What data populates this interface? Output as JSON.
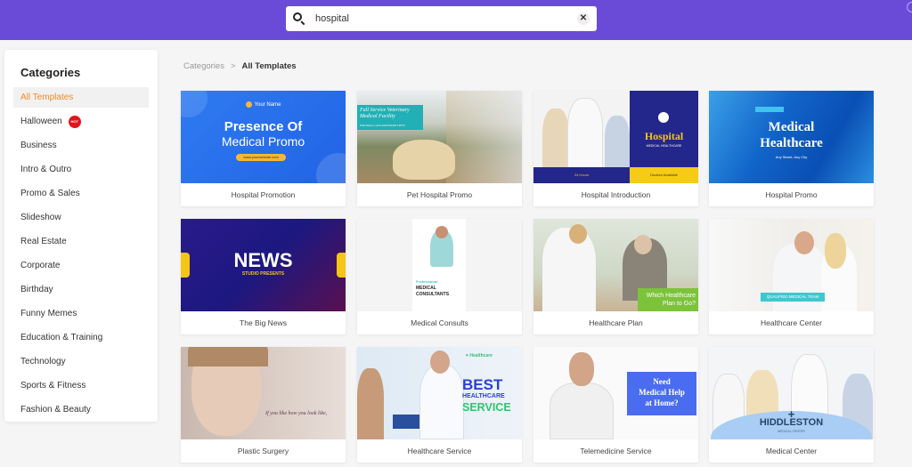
{
  "search": {
    "value": "hospital",
    "icon": "search-icon",
    "clear_icon": "close-icon"
  },
  "sidebar": {
    "title": "Categories",
    "items": [
      {
        "label": "All Templates",
        "active": true
      },
      {
        "label": "Halloween",
        "badge": "HOT"
      },
      {
        "label": "Business"
      },
      {
        "label": "Intro & Outro"
      },
      {
        "label": "Promo & Sales"
      },
      {
        "label": "Slideshow"
      },
      {
        "label": "Real Estate"
      },
      {
        "label": "Corporate"
      },
      {
        "label": "Birthday"
      },
      {
        "label": "Funny Memes"
      },
      {
        "label": "Education & Training"
      },
      {
        "label": "Technology"
      },
      {
        "label": "Sports & Fitness"
      },
      {
        "label": "Fashion & Beauty"
      }
    ]
  },
  "breadcrumb": {
    "root": "Categories",
    "separator": ">",
    "current": "All Templates"
  },
  "colors": {
    "topbar": "#6a4bd8",
    "active_category": "#f28a24",
    "hot_badge": "#e0161b"
  },
  "templates": [
    {
      "title": "Hospital Promotion",
      "thumb_text": [
        "Your Name",
        "Presence Of",
        "Medical Promo",
        "www.yourwebsite.com"
      ]
    },
    {
      "title": "Pet Hospital Promo",
      "thumb_text": [
        "Full Service Veterinary",
        "Medical Facility",
        "FOR DOGS, CATS AND POCKET PETS"
      ]
    },
    {
      "title": "Hospital Introduction",
      "thumb_text": [
        "Hospital",
        "MEDICAL HEALTHCARE",
        "24 Hours",
        "Doctors Available"
      ]
    },
    {
      "title": "Hospital Promo",
      "thumb_text": [
        "Medical",
        "Healthcare",
        "Any Street, Any City"
      ]
    },
    {
      "title": "The Big News",
      "thumb_text": [
        "NEWS",
        "STUDIO PRESENTS"
      ]
    },
    {
      "title": "Medical Consults",
      "thumb_text": [
        "Professional",
        "MEDICAL",
        "CONSULTANTS"
      ]
    },
    {
      "title": "Healthcare Plan",
      "thumb_text": [
        "Which Healthcare",
        "Plan to Go?"
      ]
    },
    {
      "title": "Healthcare Center",
      "thumb_text": [
        "QUALIFIED MEDICAL TEAM"
      ]
    },
    {
      "title": "Plastic Surgery",
      "thumb_text": [
        "If you like how you look like,"
      ]
    },
    {
      "title": "Healthcare Service",
      "thumb_text": [
        "Healthcare",
        "BEST",
        "HEALTHCARE",
        "SERVICE"
      ]
    },
    {
      "title": "Telemedicine Service",
      "thumb_text": [
        "Need",
        "Medical Help",
        "at Home?"
      ]
    },
    {
      "title": "Medical Center",
      "thumb_text": [
        "+",
        "HIDDLESTON",
        "MEDICAL CENTER"
      ]
    }
  ]
}
